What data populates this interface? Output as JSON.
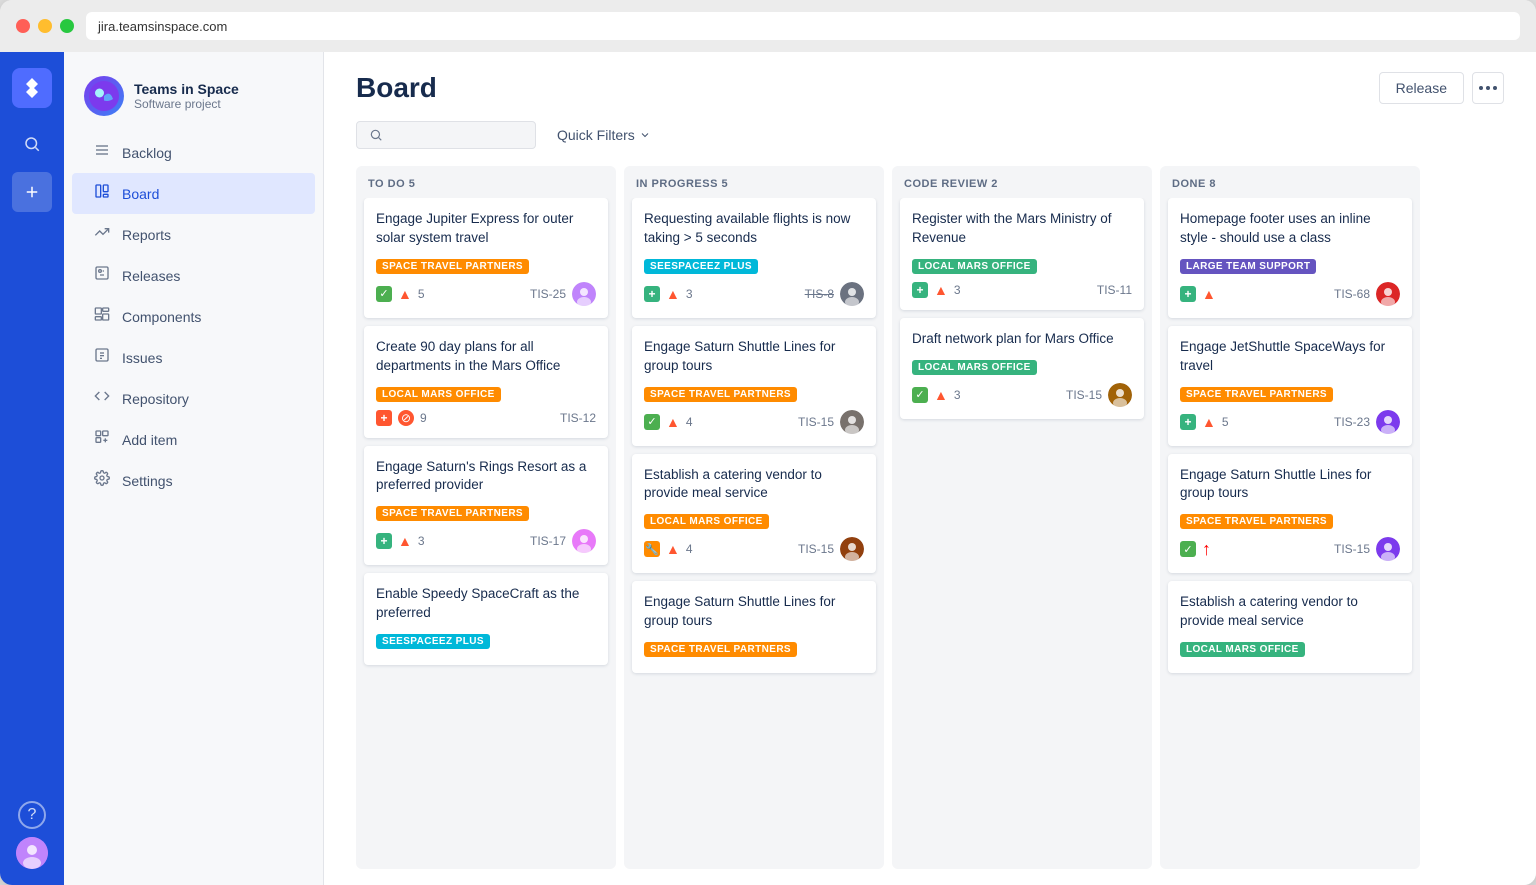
{
  "titlebar": {
    "url": "jira.teamsinspace.com",
    "controls": [
      "red",
      "yellow",
      "green"
    ]
  },
  "sidebar": {
    "project_name": "Teams in Space",
    "project_sub": "Software project",
    "nav_items": [
      {
        "id": "backlog",
        "label": "Backlog",
        "icon": "≡"
      },
      {
        "id": "board",
        "label": "Board",
        "icon": "⊞",
        "active": true
      },
      {
        "id": "reports",
        "label": "Reports",
        "icon": "↗"
      },
      {
        "id": "releases",
        "label": "Releases",
        "icon": "⊡"
      },
      {
        "id": "components",
        "label": "Components",
        "icon": "📦"
      },
      {
        "id": "issues",
        "label": "Issues",
        "icon": "⊟"
      },
      {
        "id": "repository",
        "label": "Repository",
        "icon": "<>"
      },
      {
        "id": "add-item",
        "label": "Add item",
        "icon": "+"
      },
      {
        "id": "settings",
        "label": "Settings",
        "icon": "⚙"
      }
    ]
  },
  "board": {
    "title": "Board",
    "release_btn": "Release",
    "quick_filter_label": "Quick Filters"
  },
  "columns": [
    {
      "id": "todo",
      "title": "TO DO",
      "count": 5,
      "cards": [
        {
          "title": "Engage Jupiter Express for outer solar system travel",
          "label": "SPACE TRAVEL PARTNERS",
          "label_class": "label-orange",
          "icon_type": "check",
          "icon2": "up",
          "count": "5",
          "id": "TIS-25",
          "has_avatar": true,
          "avatar_color": "#c084fc"
        },
        {
          "title": "Create 90 day plans for all departments in the Mars Office",
          "label": "LOCAL MARS OFFICE",
          "label_class": "label-orange",
          "icon_type": "plus-red",
          "icon2": "block",
          "count": "9",
          "id": "TIS-12",
          "has_avatar": false
        },
        {
          "title": "Engage Saturn's Rings Resort as a preferred provider",
          "label": "SPACE TRAVEL PARTNERS",
          "label_class": "label-orange",
          "icon_type": "plus-green",
          "icon2": "up",
          "count": "3",
          "id": "TIS-17",
          "has_avatar": true,
          "avatar_color": "#e879f9"
        },
        {
          "title": "Enable Speedy SpaceCraft as the preferred",
          "label": "SEESPACEEZ PLUS",
          "label_class": "label-teal",
          "icon_type": null,
          "icon2": null,
          "count": "",
          "id": "",
          "has_avatar": false,
          "partial": true
        }
      ]
    },
    {
      "id": "inprogress",
      "title": "IN PROGRESS",
      "count": 5,
      "cards": [
        {
          "title": "Requesting available flights is now taking > 5 seconds",
          "label": "SEESPACEEZ PLUS",
          "label_class": "label-teal",
          "icon_type": "plus-green",
          "icon2": "up",
          "count": "3",
          "id": "TIS-8",
          "has_avatar": true,
          "avatar_color": "#6b7280",
          "id_strike": true
        },
        {
          "title": "Engage Saturn Shuttle Lines for group tours",
          "label": "SPACE TRAVEL PARTNERS",
          "label_class": "label-orange",
          "icon_type": "check",
          "icon2": "up",
          "count": "4",
          "id": "TIS-15",
          "has_avatar": true,
          "avatar_color": "#78716c"
        },
        {
          "title": "Establish a catering vendor to provide meal service",
          "label": "LOCAL MARS OFFICE",
          "label_class": "label-orange",
          "icon_type": "wrench",
          "icon2": "up",
          "count": "4",
          "id": "TIS-15",
          "has_avatar": true,
          "avatar_color": "#92400e"
        },
        {
          "title": "Engage Saturn Shuttle Lines for group tours",
          "label": "SPACE TRAVEL PARTNERS",
          "label_class": "label-orange",
          "icon_type": null,
          "icon2": null,
          "count": "",
          "id": "",
          "has_avatar": false,
          "partial": true
        }
      ]
    },
    {
      "id": "codereview",
      "title": "CODE REVIEW",
      "count": 2,
      "cards": [
        {
          "title": "Register with the Mars Ministry of Revenue",
          "label": "LOCAL MARS OFFICE",
          "label_class": "label-green",
          "icon_type": "plus-green",
          "icon2": "up",
          "count": "3",
          "id": "TIS-11",
          "has_avatar": false
        },
        {
          "title": "Draft network plan for Mars Office",
          "label": "LOCAL MARS OFFICE",
          "label_class": "label-green",
          "icon_type": "check",
          "icon2": "up",
          "count": "3",
          "id": "TIS-15",
          "has_avatar": true,
          "avatar_color": "#a16207"
        }
      ]
    },
    {
      "id": "done",
      "title": "DONE",
      "count": 8,
      "cards": [
        {
          "title": "Homepage footer uses an inline style - should use a class",
          "label": "LARGE TEAM SUPPORT",
          "label_class": "label-purple",
          "icon_type": "plus-green",
          "icon2": "up",
          "count": "",
          "id": "TIS-68",
          "has_avatar": true,
          "avatar_color": "#dc2626"
        },
        {
          "title": "Engage JetShuttle SpaceWays for travel",
          "label": "SPACE TRAVEL PARTNERS",
          "label_class": "label-orange",
          "icon_type": "plus-green",
          "icon2": "up",
          "count": "5",
          "id": "TIS-23",
          "has_avatar": true,
          "avatar_color": "#7c3aed"
        },
        {
          "title": "Engage Saturn Shuttle Lines for group tours",
          "label": "SPACE TRAVEL PARTNERS",
          "label_class": "label-orange",
          "icon_type": "check",
          "icon2": "up-red",
          "count": "",
          "id": "TIS-15",
          "has_avatar": true,
          "avatar_color": "#7c3aed"
        },
        {
          "title": "Establish a catering vendor to provide meal service",
          "label": "LOCAL MARS OFFICE",
          "label_class": "label-green",
          "icon_type": null,
          "icon2": null,
          "count": "",
          "id": "",
          "has_avatar": false,
          "partial": true
        }
      ]
    }
  ]
}
